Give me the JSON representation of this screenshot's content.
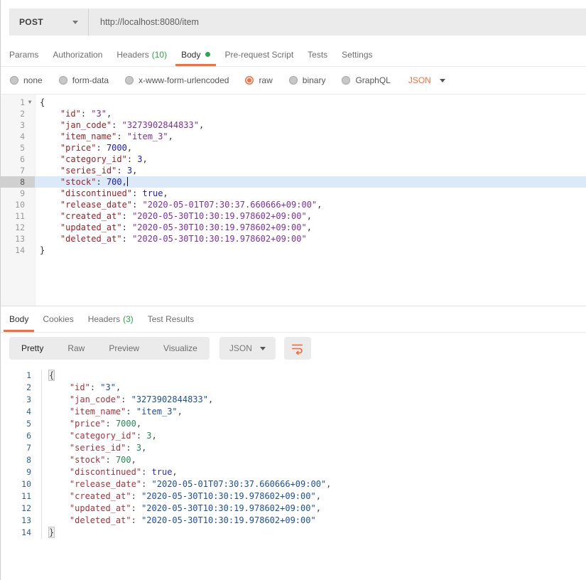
{
  "app": {
    "accent_orange": "#ff6c37",
    "green": "#29a746"
  },
  "request": {
    "method": "POST",
    "url": "http://localhost:8080/item",
    "tabs": [
      {
        "label": "Params"
      },
      {
        "label": "Authorization"
      },
      {
        "label": "Headers",
        "count": "(10)"
      },
      {
        "label": "Body",
        "active": true,
        "dot": true
      },
      {
        "label": "Pre-request Script"
      },
      {
        "label": "Tests"
      },
      {
        "label": "Settings"
      }
    ],
    "body_modes": [
      {
        "label": "none"
      },
      {
        "label": "form-data"
      },
      {
        "label": "x-www-form-urlencoded"
      },
      {
        "label": "raw",
        "selected": true
      },
      {
        "label": "binary"
      },
      {
        "label": "GraphQL"
      }
    ],
    "language": "JSON",
    "editor": {
      "active_line": 8,
      "lines": [
        {
          "n": 1,
          "fold": true,
          "tokens": [
            [
              "p",
              "{"
            ]
          ]
        },
        {
          "n": 2,
          "tokens": [
            [
              "p",
              "    "
            ],
            [
              "k",
              "\"id\""
            ],
            [
              "p",
              ": "
            ],
            [
              "s",
              "\"3\""
            ],
            [
              "p",
              ","
            ]
          ]
        },
        {
          "n": 3,
          "tokens": [
            [
              "p",
              "    "
            ],
            [
              "k",
              "\"jan_code\""
            ],
            [
              "p",
              ": "
            ],
            [
              "s",
              "\"3273902844833\""
            ],
            [
              "p",
              ","
            ]
          ]
        },
        {
          "n": 4,
          "tokens": [
            [
              "p",
              "    "
            ],
            [
              "k",
              "\"item_name\""
            ],
            [
              "p",
              ": "
            ],
            [
              "s",
              "\"item_3\""
            ],
            [
              "p",
              ","
            ]
          ]
        },
        {
          "n": 5,
          "tokens": [
            [
              "p",
              "    "
            ],
            [
              "k",
              "\"price\""
            ],
            [
              "p",
              ": "
            ],
            [
              "n",
              "7000"
            ],
            [
              "p",
              ","
            ]
          ]
        },
        {
          "n": 6,
          "tokens": [
            [
              "p",
              "    "
            ],
            [
              "k",
              "\"category_id\""
            ],
            [
              "p",
              ": "
            ],
            [
              "n",
              "3"
            ],
            [
              "p",
              ","
            ]
          ]
        },
        {
          "n": 7,
          "tokens": [
            [
              "p",
              "    "
            ],
            [
              "k",
              "\"series_id\""
            ],
            [
              "p",
              ": "
            ],
            [
              "n",
              "3"
            ],
            [
              "p",
              ","
            ]
          ]
        },
        {
          "n": 8,
          "active": true,
          "cursor": true,
          "tokens": [
            [
              "p",
              "    "
            ],
            [
              "k",
              "\"stock\""
            ],
            [
              "p",
              ": "
            ],
            [
              "n",
              "700"
            ],
            [
              "p",
              ","
            ]
          ]
        },
        {
          "n": 9,
          "tokens": [
            [
              "p",
              "    "
            ],
            [
              "k",
              "\"discontinued\""
            ],
            [
              "p",
              ": "
            ],
            [
              "b",
              "true"
            ],
            [
              "p",
              ","
            ]
          ]
        },
        {
          "n": 10,
          "tokens": [
            [
              "p",
              "    "
            ],
            [
              "k",
              "\"release_date\""
            ],
            [
              "p",
              ": "
            ],
            [
              "s",
              "\"2020-05-01T07:30:37.660666+09:00\""
            ],
            [
              "p",
              ","
            ]
          ]
        },
        {
          "n": 11,
          "tokens": [
            [
              "p",
              "    "
            ],
            [
              "k",
              "\"created_at\""
            ],
            [
              "p",
              ": "
            ],
            [
              "s",
              "\"2020-05-30T10:30:19.978602+09:00\""
            ],
            [
              "p",
              ","
            ]
          ]
        },
        {
          "n": 12,
          "tokens": [
            [
              "p",
              "    "
            ],
            [
              "k",
              "\"updated_at\""
            ],
            [
              "p",
              ": "
            ],
            [
              "s",
              "\"2020-05-30T10:30:19.978602+09:00\""
            ],
            [
              "p",
              ","
            ]
          ]
        },
        {
          "n": 13,
          "tokens": [
            [
              "p",
              "    "
            ],
            [
              "k",
              "\"deleted_at\""
            ],
            [
              "p",
              ": "
            ],
            [
              "s",
              "\"2020-05-30T10:30:19.978602+09:00\""
            ]
          ]
        },
        {
          "n": 14,
          "tokens": [
            [
              "p",
              "}"
            ]
          ]
        }
      ]
    }
  },
  "response": {
    "tabs": [
      {
        "label": "Body",
        "active": true
      },
      {
        "label": "Cookies"
      },
      {
        "label": "Headers",
        "count": "(3)"
      },
      {
        "label": "Test Results"
      }
    ],
    "views": [
      {
        "label": "Pretty",
        "active": true
      },
      {
        "label": "Raw"
      },
      {
        "label": "Preview"
      },
      {
        "label": "Visualize"
      }
    ],
    "language": "JSON",
    "viewer": {
      "lines": [
        {
          "n": 1,
          "tokens": [
            [
              "m",
              "{"
            ]
          ]
        },
        {
          "n": 2,
          "tokens": [
            [
              "p",
              "    "
            ],
            [
              "k",
              "\"id\""
            ],
            [
              "p",
              ": "
            ],
            [
              "s",
              "\"3\""
            ],
            [
              "p",
              ","
            ]
          ]
        },
        {
          "n": 3,
          "tokens": [
            [
              "p",
              "    "
            ],
            [
              "k",
              "\"jan_code\""
            ],
            [
              "p",
              ": "
            ],
            [
              "s",
              "\"3273902844833\""
            ],
            [
              "p",
              ","
            ]
          ]
        },
        {
          "n": 4,
          "tokens": [
            [
              "p",
              "    "
            ],
            [
              "k",
              "\"item_name\""
            ],
            [
              "p",
              ": "
            ],
            [
              "s",
              "\"item_3\""
            ],
            [
              "p",
              ","
            ]
          ]
        },
        {
          "n": 5,
          "tokens": [
            [
              "p",
              "    "
            ],
            [
              "k",
              "\"price\""
            ],
            [
              "p",
              ": "
            ],
            [
              "n",
              "7000"
            ],
            [
              "p",
              ","
            ]
          ]
        },
        {
          "n": 6,
          "tokens": [
            [
              "p",
              "    "
            ],
            [
              "k",
              "\"category_id\""
            ],
            [
              "p",
              ": "
            ],
            [
              "n",
              "3"
            ],
            [
              "p",
              ","
            ]
          ]
        },
        {
          "n": 7,
          "tokens": [
            [
              "p",
              "    "
            ],
            [
              "k",
              "\"series_id\""
            ],
            [
              "p",
              ": "
            ],
            [
              "n",
              "3"
            ],
            [
              "p",
              ","
            ]
          ]
        },
        {
          "n": 8,
          "tokens": [
            [
              "p",
              "    "
            ],
            [
              "k",
              "\"stock\""
            ],
            [
              "p",
              ": "
            ],
            [
              "n",
              "700"
            ],
            [
              "p",
              ","
            ]
          ]
        },
        {
          "n": 9,
          "tokens": [
            [
              "p",
              "    "
            ],
            [
              "k",
              "\"discontinued\""
            ],
            [
              "p",
              ": "
            ],
            [
              "b",
              "true"
            ],
            [
              "p",
              ","
            ]
          ]
        },
        {
          "n": 10,
          "tokens": [
            [
              "p",
              "    "
            ],
            [
              "k",
              "\"release_date\""
            ],
            [
              "p",
              ": "
            ],
            [
              "s",
              "\"2020-05-01T07:30:37.660666+09:00\""
            ],
            [
              "p",
              ","
            ]
          ]
        },
        {
          "n": 11,
          "tokens": [
            [
              "p",
              "    "
            ],
            [
              "k",
              "\"created_at\""
            ],
            [
              "p",
              ": "
            ],
            [
              "s",
              "\"2020-05-30T10:30:19.978602+09:00\""
            ],
            [
              "p",
              ","
            ]
          ]
        },
        {
          "n": 12,
          "tokens": [
            [
              "p",
              "    "
            ],
            [
              "k",
              "\"updated_at\""
            ],
            [
              "p",
              ": "
            ],
            [
              "s",
              "\"2020-05-30T10:30:19.978602+09:00\""
            ],
            [
              "p",
              ","
            ]
          ]
        },
        {
          "n": 13,
          "tokens": [
            [
              "p",
              "    "
            ],
            [
              "k",
              "\"deleted_at\""
            ],
            [
              "p",
              ": "
            ],
            [
              "s",
              "\"2020-05-30T10:30:19.978602+09:00\""
            ]
          ]
        },
        {
          "n": 14,
          "tokens": [
            [
              "m",
              "}"
            ]
          ]
        }
      ]
    }
  }
}
